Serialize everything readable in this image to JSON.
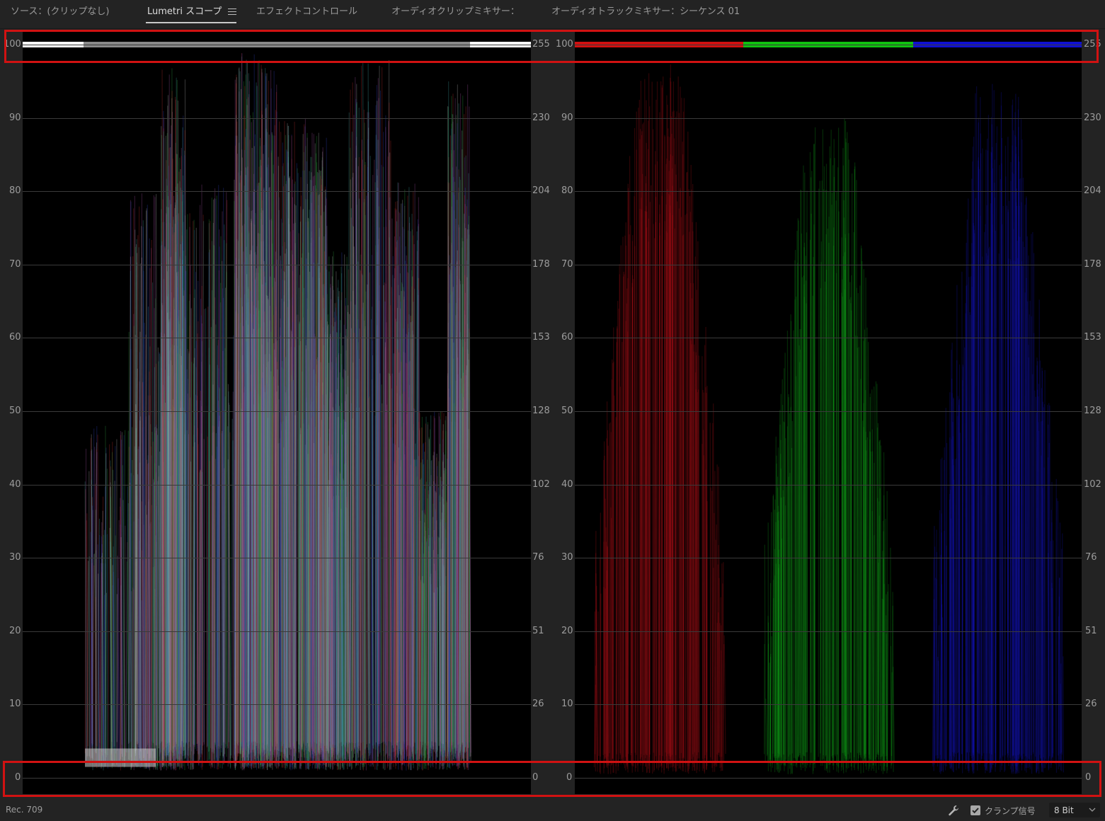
{
  "tabs": [
    {
      "label": "ソース：(クリップなし)",
      "active": false
    },
    {
      "label": "Lumetri スコープ",
      "active": true
    },
    {
      "label": "エフェクトコントロール",
      "active": false
    },
    {
      "label": "オーディオクリップミキサー：",
      "active": false
    },
    {
      "label": "オーディオトラックミキサー：シーケンス 01",
      "active": false
    }
  ],
  "scopes": {
    "ire_labels": [
      "100",
      "90",
      "80",
      "70",
      "60",
      "50",
      "40",
      "30",
      "20",
      "10",
      "0"
    ],
    "code_labels": [
      "255",
      "230",
      "204",
      "178",
      "153",
      "128",
      "102",
      "76",
      "51",
      "26",
      "0"
    ],
    "left": {
      "type": "rgb-overlay"
    },
    "right": {
      "type": "rgb-parade",
      "channels": [
        "red",
        "green",
        "blue"
      ]
    }
  },
  "colors": {
    "highlight": "#d11212",
    "red": "#c8141a",
    "green": "#12b81a",
    "blue": "#1818d0"
  },
  "status": {
    "color_space": "Rec. 709",
    "clamp_label": "クランプ信号",
    "clamp_checked": true,
    "bit_depth": "8 Bit"
  },
  "icons": [
    "menu-icon",
    "wrench-icon",
    "checkmark-icon",
    "chevron-down-icon"
  ]
}
